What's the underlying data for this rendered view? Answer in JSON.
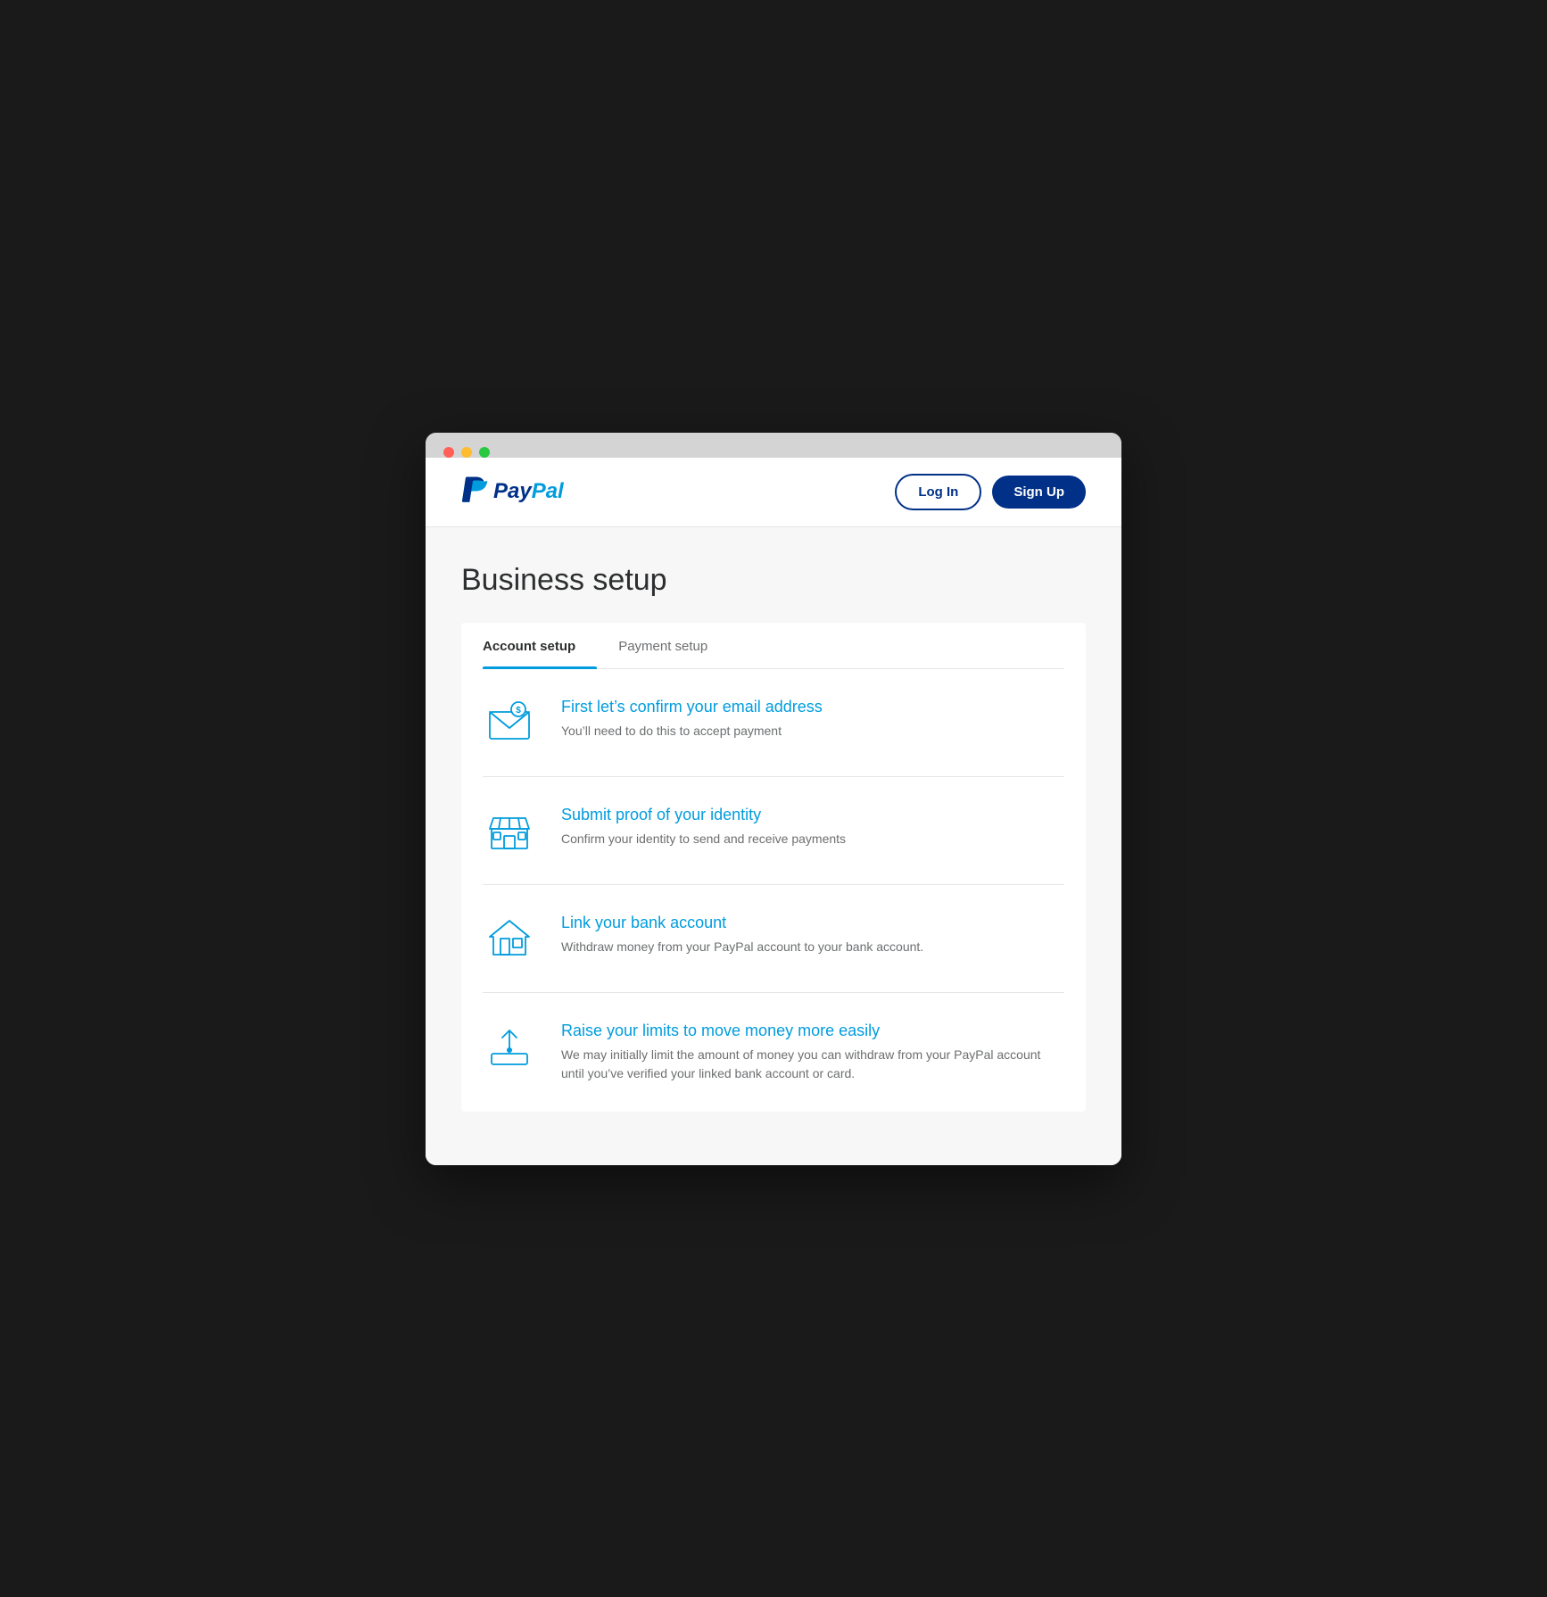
{
  "browser": {
    "dots": [
      "red",
      "yellow",
      "green"
    ]
  },
  "header": {
    "logo_text_pay": "Pay",
    "logo_text_pal": "Pal",
    "login_label": "Log In",
    "signup_label": "Sign Up"
  },
  "page": {
    "title": "Business setup"
  },
  "tabs": [
    {
      "id": "account-setup",
      "label": "Account setup",
      "active": true
    },
    {
      "id": "payment-setup",
      "label": "Payment setup",
      "active": false
    }
  ],
  "setup_items": [
    {
      "id": "confirm-email",
      "title": "First let’s confirm your email address",
      "description": "You’ll need to do this to accept payment",
      "icon": "email"
    },
    {
      "id": "submit-identity",
      "title": "Submit proof of your identity",
      "description": "Confirm your identity to send and receive payments",
      "icon": "store"
    },
    {
      "id": "link-bank",
      "title": "Link your bank account",
      "description": "Withdraw money from your PayPal account to your bank account.",
      "icon": "bank"
    },
    {
      "id": "raise-limits",
      "title": "Raise your limits to move money more easily",
      "description": "We may initially limit the amount of money you can withdraw from your PayPal account until you’ve verified your linked bank account or card.",
      "icon": "upload"
    }
  ]
}
